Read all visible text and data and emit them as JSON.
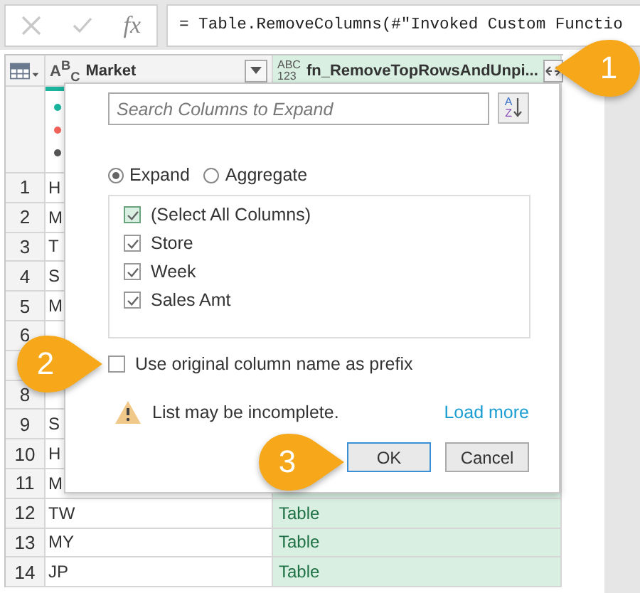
{
  "formula_bar": {
    "fx": "fx",
    "formula": "= Table.RemoveColumns(#\"Invoked Custom Functio"
  },
  "table": {
    "columns": [
      {
        "type_label": "A$^{B}$$_{C}$",
        "name": "Market",
        "kind": "filter",
        "selected": false
      },
      {
        "type_label": "ABC",
        "type_label_2": "123",
        "name": "fn_RemoveTopRowsAndUnpi...",
        "kind": "expand",
        "selected": true
      }
    ],
    "quality": [
      {
        "color": "#1ab39c"
      },
      {
        "color": "#f0625a"
      },
      {
        "color": "#555555"
      }
    ],
    "rows": [
      {
        "number": "1",
        "market": "H"
      },
      {
        "number": "2",
        "market": "M"
      },
      {
        "number": "3",
        "market": "T"
      },
      {
        "number": "4",
        "market": "S"
      },
      {
        "number": "5",
        "market": "M"
      },
      {
        "number": "6"
      },
      {},
      {
        "number": "8"
      },
      {
        "number": "9",
        "market": "S"
      },
      {
        "number": "10",
        "market": "H"
      },
      {
        "number": "11",
        "market": "M"
      },
      {
        "number": "12",
        "market": "TW",
        "fn": "Table"
      },
      {
        "number": "13",
        "market": "MY",
        "fn": "Table"
      },
      {
        "number": "14",
        "market": "JP",
        "fn": "Table"
      }
    ]
  },
  "dialog": {
    "search": {
      "placeholder": "Search Columns to Expand"
    },
    "sort_label": "A",
    "sort_label_2": "Z",
    "modes": [
      {
        "label": "Expand",
        "selected": true
      },
      {
        "label": "Aggregate",
        "selected": false
      }
    ],
    "columns": [
      {
        "label": "(Select All Columns)",
        "kind": "all",
        "checked": true
      },
      {
        "label": "Store",
        "kind": "column",
        "checked": true
      },
      {
        "label": "Week",
        "kind": "column",
        "checked": true
      },
      {
        "label": "Sales Amt",
        "kind": "column",
        "checked": true
      }
    ],
    "prefix": {
      "label": "Use original column name as prefix",
      "checked": false
    },
    "warning": "List may be incomplete.",
    "load_more": "Load more",
    "buttons": [
      {
        "label": "OK",
        "selected": true
      },
      {
        "label": "Cancel",
        "selected": false
      }
    ]
  },
  "callouts": [
    {
      "number": "1",
      "kind": "left"
    },
    {
      "number": "2",
      "kind": "right"
    },
    {
      "number": "3",
      "kind": "right"
    }
  ]
}
